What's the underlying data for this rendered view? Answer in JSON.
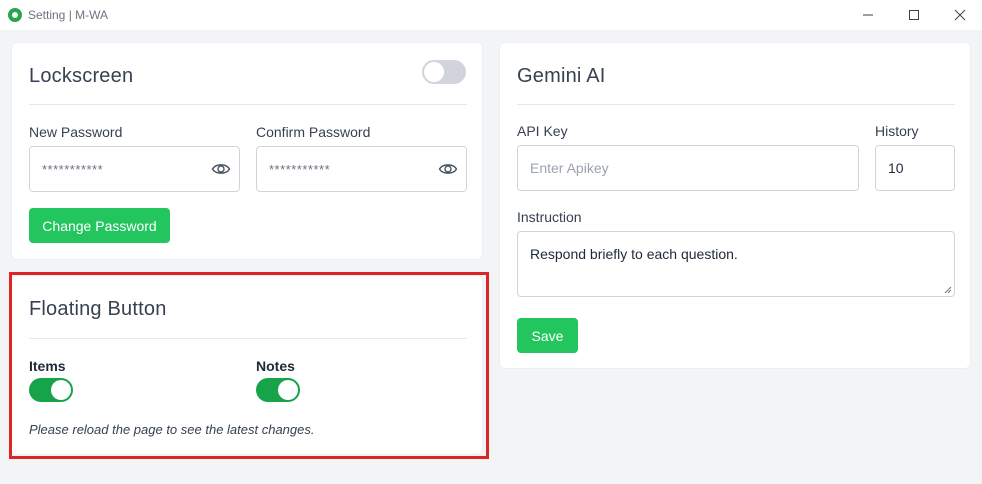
{
  "window": {
    "title": "Setting | M-WA",
    "icon": "whatsapp-icon"
  },
  "lockscreen": {
    "title": "Lockscreen",
    "enabled": false,
    "new_password_label": "New Password",
    "new_password_value": "***********",
    "confirm_password_label": "Confirm Password",
    "confirm_password_value": "***********",
    "change_button": "Change Password"
  },
  "floating": {
    "title": "Floating Button",
    "items_label": "Items",
    "items_enabled": true,
    "notes_label": "Notes",
    "notes_enabled": true,
    "reload_note": "Please reload the page to see the latest changes."
  },
  "gemini": {
    "title": "Gemini AI",
    "api_key_label": "API Key",
    "api_key_placeholder": "Enter Apikey",
    "history_label": "History",
    "history_value": "10",
    "instruction_label": "Instruction",
    "instruction_value": "Respond briefly to each question.",
    "save_button": "Save"
  },
  "colors": {
    "accent": "#22c55e",
    "toggle_on": "#16a34a",
    "highlight": "#dc2626"
  }
}
